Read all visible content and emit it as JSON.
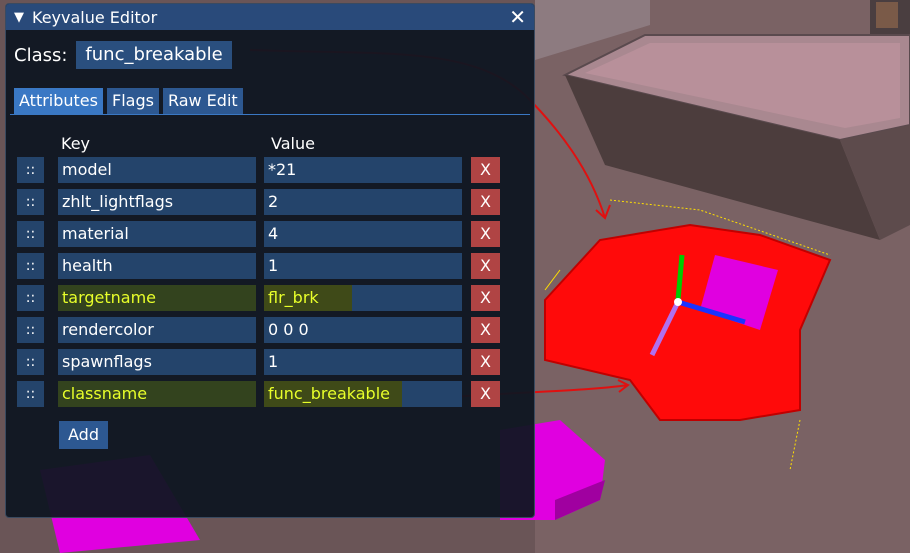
{
  "window": {
    "title": "Keyvalue Editor",
    "collapse_icon": "triangle-down-icon",
    "close_icon": "close-icon",
    "close_glyph": "✕"
  },
  "class": {
    "label": "Class:",
    "value": "func_breakable"
  },
  "tabs": [
    {
      "label": "Attributes",
      "active": true
    },
    {
      "label": "Flags",
      "active": false
    },
    {
      "label": "Raw Edit",
      "active": false
    }
  ],
  "table": {
    "key_header": "Key",
    "value_header": "Value",
    "handle_glyph": "::",
    "delete_glyph": "X",
    "rows": [
      {
        "key": "model",
        "value": "*21"
      },
      {
        "key": "zhlt_lightflags",
        "value": "2"
      },
      {
        "key": "material",
        "value": "4"
      },
      {
        "key": "health",
        "value": "1"
      },
      {
        "key": "targetname",
        "value": "flr_brk",
        "highlighted": true
      },
      {
        "key": "rendercolor",
        "value": "0 0 0"
      },
      {
        "key": "spawnflags",
        "value": "1"
      },
      {
        "key": "classname",
        "value": "func_breakable",
        "highlighted": true
      }
    ]
  },
  "add_label": "Add",
  "colors": {
    "accent": "#3a78c4",
    "field_bg": "#24446b",
    "delete_bg": "#b04444",
    "highlight_text": "#e8ff2a",
    "selection_red": "#ff0000",
    "gizmo_magenta": "#e000e0"
  }
}
